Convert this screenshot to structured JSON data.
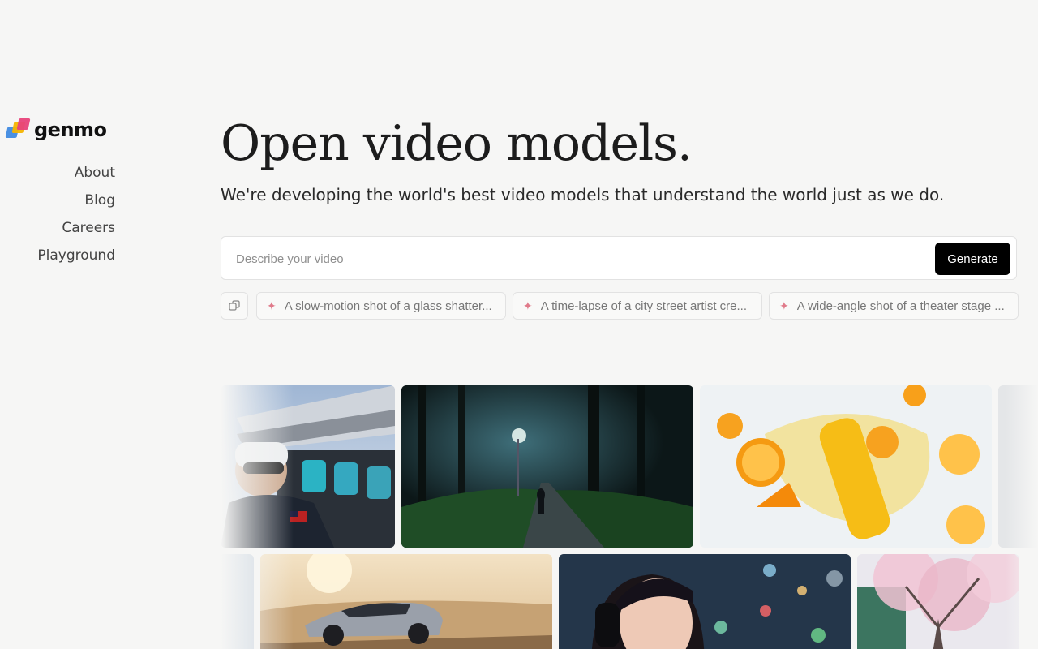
{
  "brand": {
    "name": "genmo"
  },
  "nav": {
    "items": [
      {
        "label": "About"
      },
      {
        "label": "Blog"
      },
      {
        "label": "Careers"
      },
      {
        "label": "Playground"
      }
    ]
  },
  "hero": {
    "title": "Open video models.",
    "subtitle": "We're developing the world's best video models that understand the world just as we do."
  },
  "prompt": {
    "placeholder": "Describe your video",
    "value": "",
    "generate_label": "Generate"
  },
  "suggestions": {
    "shuffle_icon": "shuffle-icon",
    "items": [
      {
        "label": "A slow-motion shot of a glass shatter..."
      },
      {
        "label": "A time-lapse of a city street artist cre..."
      },
      {
        "label": "A wide-angle shot of a theater stage ..."
      }
    ]
  },
  "gallery": {
    "tiles": [
      {
        "subject": "pilot-in-aircraft"
      },
      {
        "subject": "night-forest-path"
      },
      {
        "subject": "orange-juice-splash"
      },
      {
        "subject": "partial-tile"
      },
      {
        "subject": "partial-tile"
      },
      {
        "subject": "sports-car-desert"
      },
      {
        "subject": "woman-headphones-bokeh"
      },
      {
        "subject": "blossom-tree"
      }
    ]
  },
  "colors": {
    "background": "#f6f6f5",
    "button": "#000000",
    "sparkle": "#e07a8a"
  }
}
